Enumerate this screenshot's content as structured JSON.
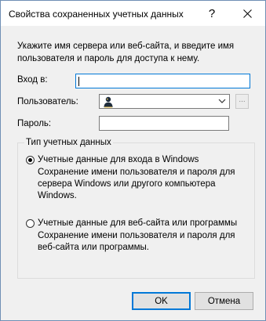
{
  "window": {
    "title": "Свойства сохраненных учетных данных",
    "help_glyph": "?",
    "close_glyph": "✕"
  },
  "form": {
    "intro": "Укажите имя сервера или веб-сайта, и введите имя пользователя и пароль для доступа к нему.",
    "login_label": "Вход в:",
    "login_value": "",
    "user_label": "Пользователь:",
    "user_value": "",
    "browse_label": "...",
    "password_label": "Пароль:",
    "password_value": ""
  },
  "credential_type": {
    "legend": "Тип учетных данных",
    "options": [
      {
        "label": "Учетные данные для входа в Windows",
        "description": "Сохранение имени пользователя и пароля для сервера Windows или другого компьютера Windows.",
        "checked": true
      },
      {
        "label": "Учетные данные для веб-сайта или программы",
        "description": "Сохранение имени пользователя и пароля для веб-сайта или программы.",
        "checked": false
      }
    ]
  },
  "buttons": {
    "ok": "OK",
    "cancel": "Отмена"
  },
  "colors": {
    "focus_border": "#0078d7",
    "dialog_bg": "#f0f0f0"
  }
}
